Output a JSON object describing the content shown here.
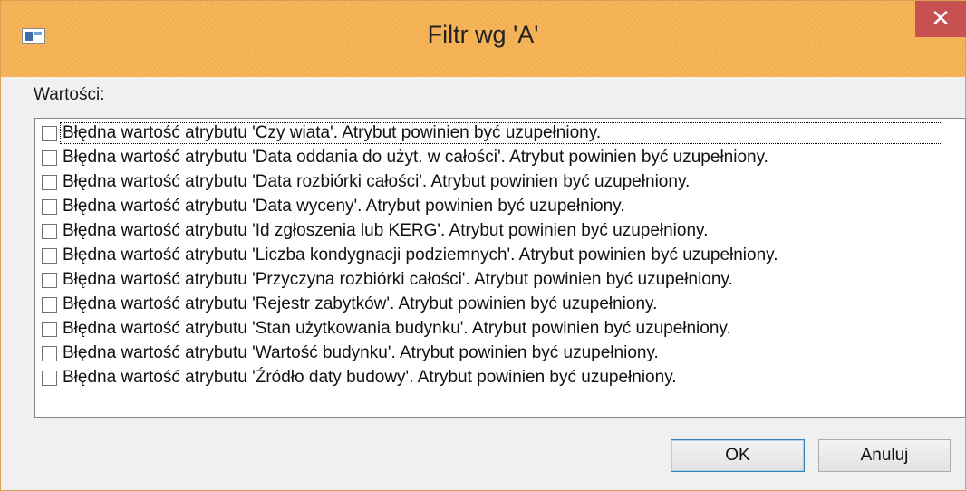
{
  "window": {
    "title": "Filtr wg 'A'",
    "close_label": "✕",
    "titlebar_color": "#f7b253"
  },
  "values_label": "Wartości:",
  "items": [
    {
      "label": "Błędna wartość atrybutu 'Czy wiata'. Atrybut powinien być uzupełniony.",
      "checked": false
    },
    {
      "label": "Błędna wartość atrybutu 'Data oddania do użyt. w całości'. Atrybut powinien być uzupełniony.",
      "checked": false
    },
    {
      "label": "Błędna wartość atrybutu 'Data rozbiórki całości'. Atrybut powinien być uzupełniony.",
      "checked": false
    },
    {
      "label": "Błędna wartość atrybutu 'Data wyceny'. Atrybut powinien być uzupełniony.",
      "checked": false
    },
    {
      "label": "Błędna wartość atrybutu 'Id zgłoszenia lub KERG'. Atrybut powinien być uzupełniony.",
      "checked": false
    },
    {
      "label": "Błędna wartość atrybutu 'Liczba kondygnacji podziemnych'. Atrybut powinien być uzupełniony.",
      "checked": false
    },
    {
      "label": "Błędna wartość atrybutu 'Przyczyna rozbiórki całości'. Atrybut powinien być uzupełniony.",
      "checked": false
    },
    {
      "label": "Błędna wartość atrybutu 'Rejestr zabytków'. Atrybut powinien być uzupełniony.",
      "checked": false
    },
    {
      "label": "Błędna wartość atrybutu 'Stan użytkowania budynku'. Atrybut powinien być uzupełniony.",
      "checked": false
    },
    {
      "label": "Błędna wartość atrybutu 'Wartość budynku'. Atrybut powinien być uzupełniony.",
      "checked": false
    },
    {
      "label": "Błędna wartość atrybutu 'Źródło daty budowy'. Atrybut powinien być uzupełniony.",
      "checked": false
    }
  ],
  "buttons": {
    "ok_label": "OK",
    "cancel_label": "Anuluj"
  }
}
